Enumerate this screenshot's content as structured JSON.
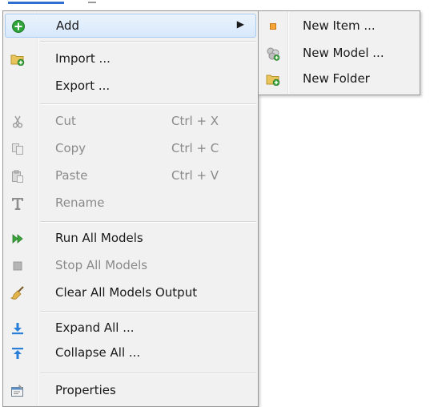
{
  "main_menu": {
    "items": [
      {
        "label": "Add",
        "icon": "add-icon",
        "has_submenu": true,
        "highlighted": true
      },
      {
        "label": "Import ...",
        "icon": "import-folder-icon"
      },
      {
        "label": "Export ..."
      },
      {
        "label": "Cut",
        "shortcut": "Ctrl + X",
        "icon": "cut-icon",
        "disabled": true
      },
      {
        "label": "Copy",
        "shortcut": "Ctrl + C",
        "icon": "copy-icon",
        "disabled": true
      },
      {
        "label": "Paste",
        "shortcut": "Ctrl + V",
        "icon": "paste-icon",
        "disabled": true
      },
      {
        "label": "Rename",
        "icon": "rename-icon",
        "disabled": true
      },
      {
        "label": "Run All Models",
        "icon": "run-all-icon"
      },
      {
        "label": "Stop All Models",
        "icon": "stop-icon",
        "disabled": true
      },
      {
        "label": "Clear All Models Output",
        "icon": "broom-icon"
      },
      {
        "label": "Expand All ...",
        "icon": "expand-all-icon"
      },
      {
        "label": "Collapse All ...",
        "icon": "collapse-all-icon"
      },
      {
        "label": "Properties",
        "icon": "properties-icon"
      }
    ],
    "submenu_arrow": "▶"
  },
  "sub_menu": {
    "items": [
      {
        "label": "New Item ...",
        "icon": "new-item-icon"
      },
      {
        "label": "New Model ...",
        "icon": "new-model-icon"
      },
      {
        "label": "New Folder",
        "icon": "new-folder-icon"
      }
    ]
  },
  "colors": {
    "menu_bg": "#f1f1f1",
    "highlight_border": "#a8cbef",
    "disabled_text": "#8a8a8a",
    "add_green": "#2fa43a",
    "run_green": "#3aa63a",
    "arrow_blue": "#2a7fd8"
  }
}
